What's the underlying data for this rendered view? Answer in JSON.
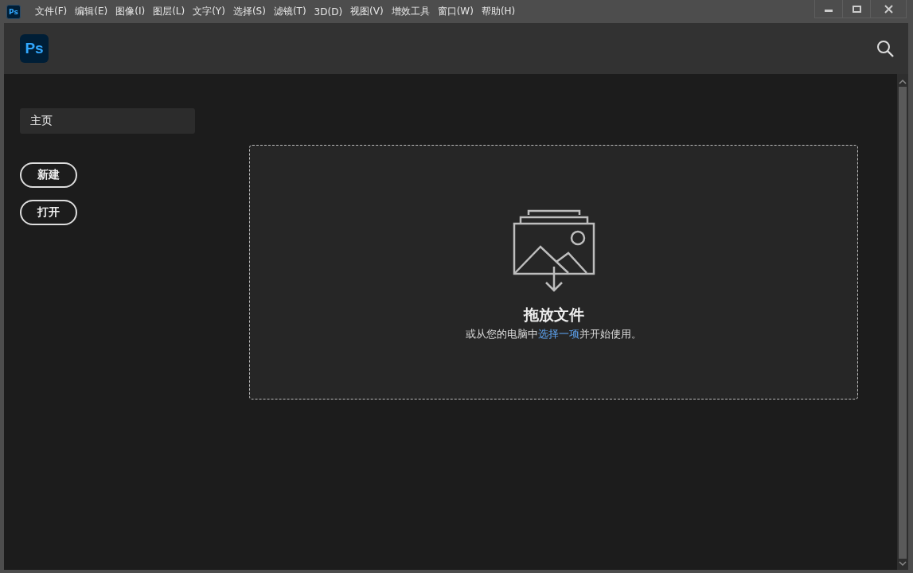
{
  "app_icon": {
    "label": "Ps"
  },
  "menu": [
    {
      "label": "文件(F)"
    },
    {
      "label": "编辑(E)"
    },
    {
      "label": "图像(I)"
    },
    {
      "label": "图层(L)"
    },
    {
      "label": "文字(Y)"
    },
    {
      "label": "选择(S)"
    },
    {
      "label": "滤镜(T)"
    },
    {
      "label": "3D(D)"
    },
    {
      "label": "视图(V)"
    },
    {
      "label": "增效工具"
    },
    {
      "label": "窗口(W)"
    },
    {
      "label": "帮助(H)"
    }
  ],
  "header": {
    "logo": "Ps"
  },
  "sidebar": {
    "items": [
      {
        "label": "主页",
        "selected": true
      }
    ],
    "buttons": [
      {
        "label": "新建"
      },
      {
        "label": "打开"
      }
    ]
  },
  "drop_zone": {
    "title": "拖放文件",
    "hint_before": "或从您的电脑中",
    "hint_link": "选择一项",
    "hint_after": "并开始使用。"
  }
}
